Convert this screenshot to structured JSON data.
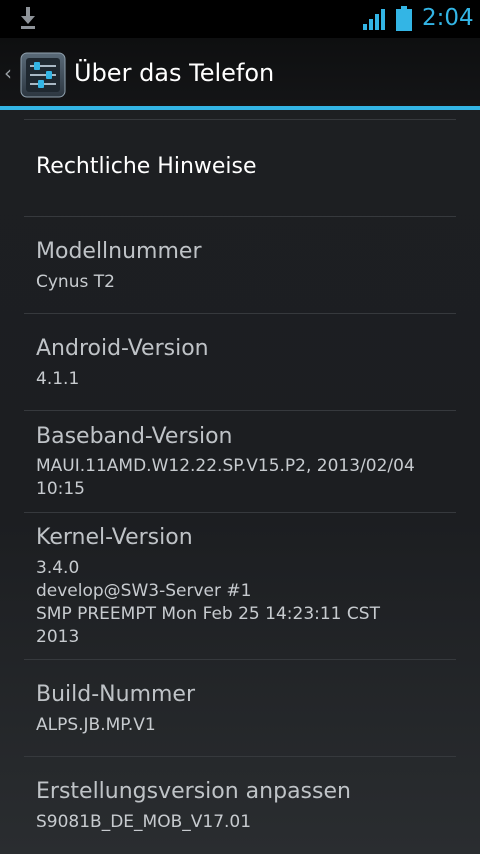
{
  "status_bar": {
    "time": "2:04",
    "accent_color": "#33b5e5",
    "icons": [
      "download-icon",
      "signal-icon",
      "battery-icon"
    ]
  },
  "action_bar": {
    "title": "Über das Telefon",
    "up_icon": "‹",
    "app_icon": "settings-icon"
  },
  "items": [
    {
      "title": "Rechtliche Hinweise"
    },
    {
      "title": "Modellnummer",
      "summary": "Cynus T2"
    },
    {
      "title": "Android-Version",
      "summary": "4.1.1"
    },
    {
      "title": "Baseband-Version",
      "summary": "MAUI.11AMD.W12.22.SP.V15.P2, 2013/02/04\n10:15"
    },
    {
      "title": "Kernel-Version",
      "summary": "3.4.0\ndevelop@SW3-Server #1\nSMP PREEMPT Mon Feb 25 14:23:11 CST\n2013"
    },
    {
      "title": "Build-Nummer",
      "summary": "ALPS.JB.MP.V1"
    },
    {
      "title": "Erstellungsversion anpassen",
      "summary": "S9081B_DE_MOB_V17.01"
    }
  ]
}
